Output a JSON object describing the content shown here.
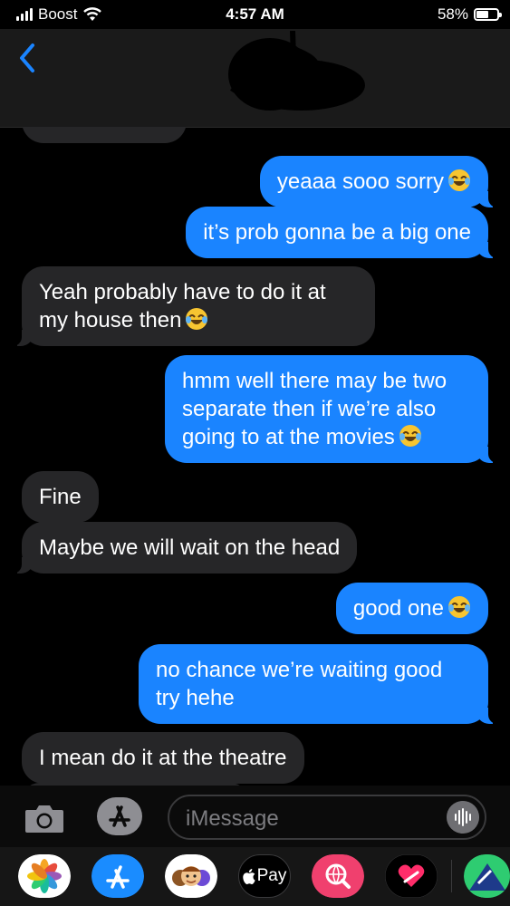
{
  "status_bar": {
    "carrier": "Boost",
    "time": "4:57 AM",
    "battery_text": "58%",
    "battery_level": 0.58
  },
  "header": {
    "back_icon": "chevron-left-icon",
    "contact": ""
  },
  "messages": [
    {
      "dir": "out",
      "text": "yeaaa sooo sorry",
      "emoji": "joy"
    },
    {
      "dir": "out",
      "text": "it’s prob gonna be a big one",
      "emoji": ""
    },
    {
      "dir": "in",
      "text": "Yeah probably  have to do it at my house then",
      "emoji": "joy"
    },
    {
      "dir": "out",
      "text": "hmm well there may be two separate then if we’re also going to at the movies",
      "emoji": "joy"
    },
    {
      "dir": "in",
      "text": "Fine",
      "emoji": ""
    },
    {
      "dir": "in",
      "text": "Maybe we will wait on the head",
      "emoji": ""
    },
    {
      "dir": "out",
      "text": "good one",
      "emoji": "joy"
    },
    {
      "dir": "out",
      "text": "no chance we’re waiting good try hehe",
      "emoji": ""
    },
    {
      "dir": "in",
      "text": "I mean do it at the theatre",
      "emoji": ""
    }
  ],
  "input": {
    "placeholder": "iMessage",
    "camera_icon": "camera-icon",
    "apps_icon": "app-store-icon",
    "audio_icon": "waveform-icon"
  },
  "app_drawer": {
    "apps": [
      "photos-icon",
      "app-store-icon",
      "memoji-icon",
      "apple-pay-icon",
      "web-search-icon",
      "digital-touch-icon",
      "game-icon"
    ],
    "pay_label": "Pay"
  },
  "colors": {
    "outgoing": "#1a84ff",
    "incoming": "#262628",
    "background": "#000000"
  }
}
